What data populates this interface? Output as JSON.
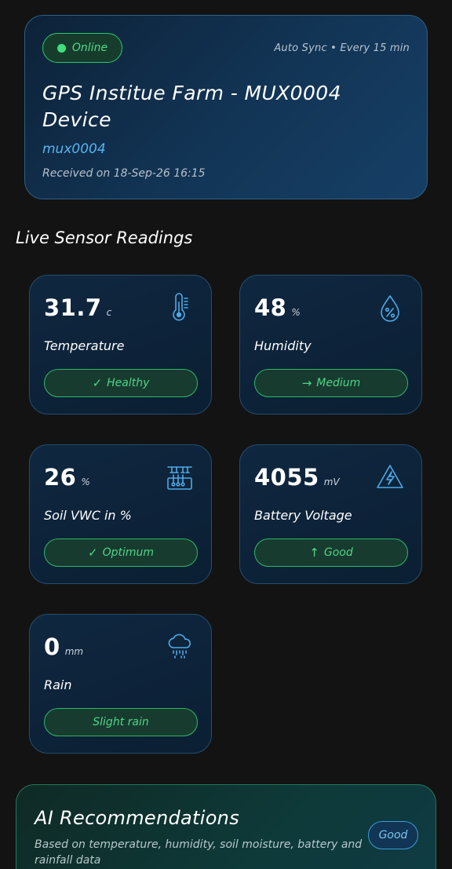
{
  "device": {
    "status": "Online",
    "sync_text": "Auto Sync • Every 15 min",
    "title": "GPS Institue Farm - MUX0004 Device",
    "device_id": "mux0004",
    "received": "Received on 18-Sep-26 16:15"
  },
  "section_title": "Live Sensor Readings",
  "sensors": [
    {
      "value": "31.7",
      "unit": "c",
      "label": "Temperature",
      "status": "Healthy",
      "status_glyph": "✓",
      "icon": "thermometer-icon"
    },
    {
      "value": "48",
      "unit": "%",
      "label": "Humidity",
      "status": "Medium",
      "status_glyph": "→",
      "icon": "humidity-drop-icon"
    },
    {
      "value": "26",
      "unit": "%",
      "label": "Soil VWC in %",
      "status": "Optimum",
      "status_glyph": "✓",
      "icon": "soil-sensor-icon"
    },
    {
      "value": "4055",
      "unit": "mV",
      "label": "Battery Voltage",
      "status": "Good",
      "status_glyph": "↑",
      "icon": "voltage-icon"
    },
    {
      "value": "0",
      "unit": "mm",
      "label": "Rain",
      "status": "Slight rain",
      "status_glyph": "",
      "icon": "rain-cloud-icon"
    }
  ],
  "ai": {
    "title": "AI Recommendations",
    "description": "Based on temperature, humidity, soil moisture, battery and rainfall data",
    "badge": "Good"
  },
  "colors": {
    "accent_green": "#4fd586",
    "accent_blue": "#58b3f2",
    "background": "#131313"
  }
}
